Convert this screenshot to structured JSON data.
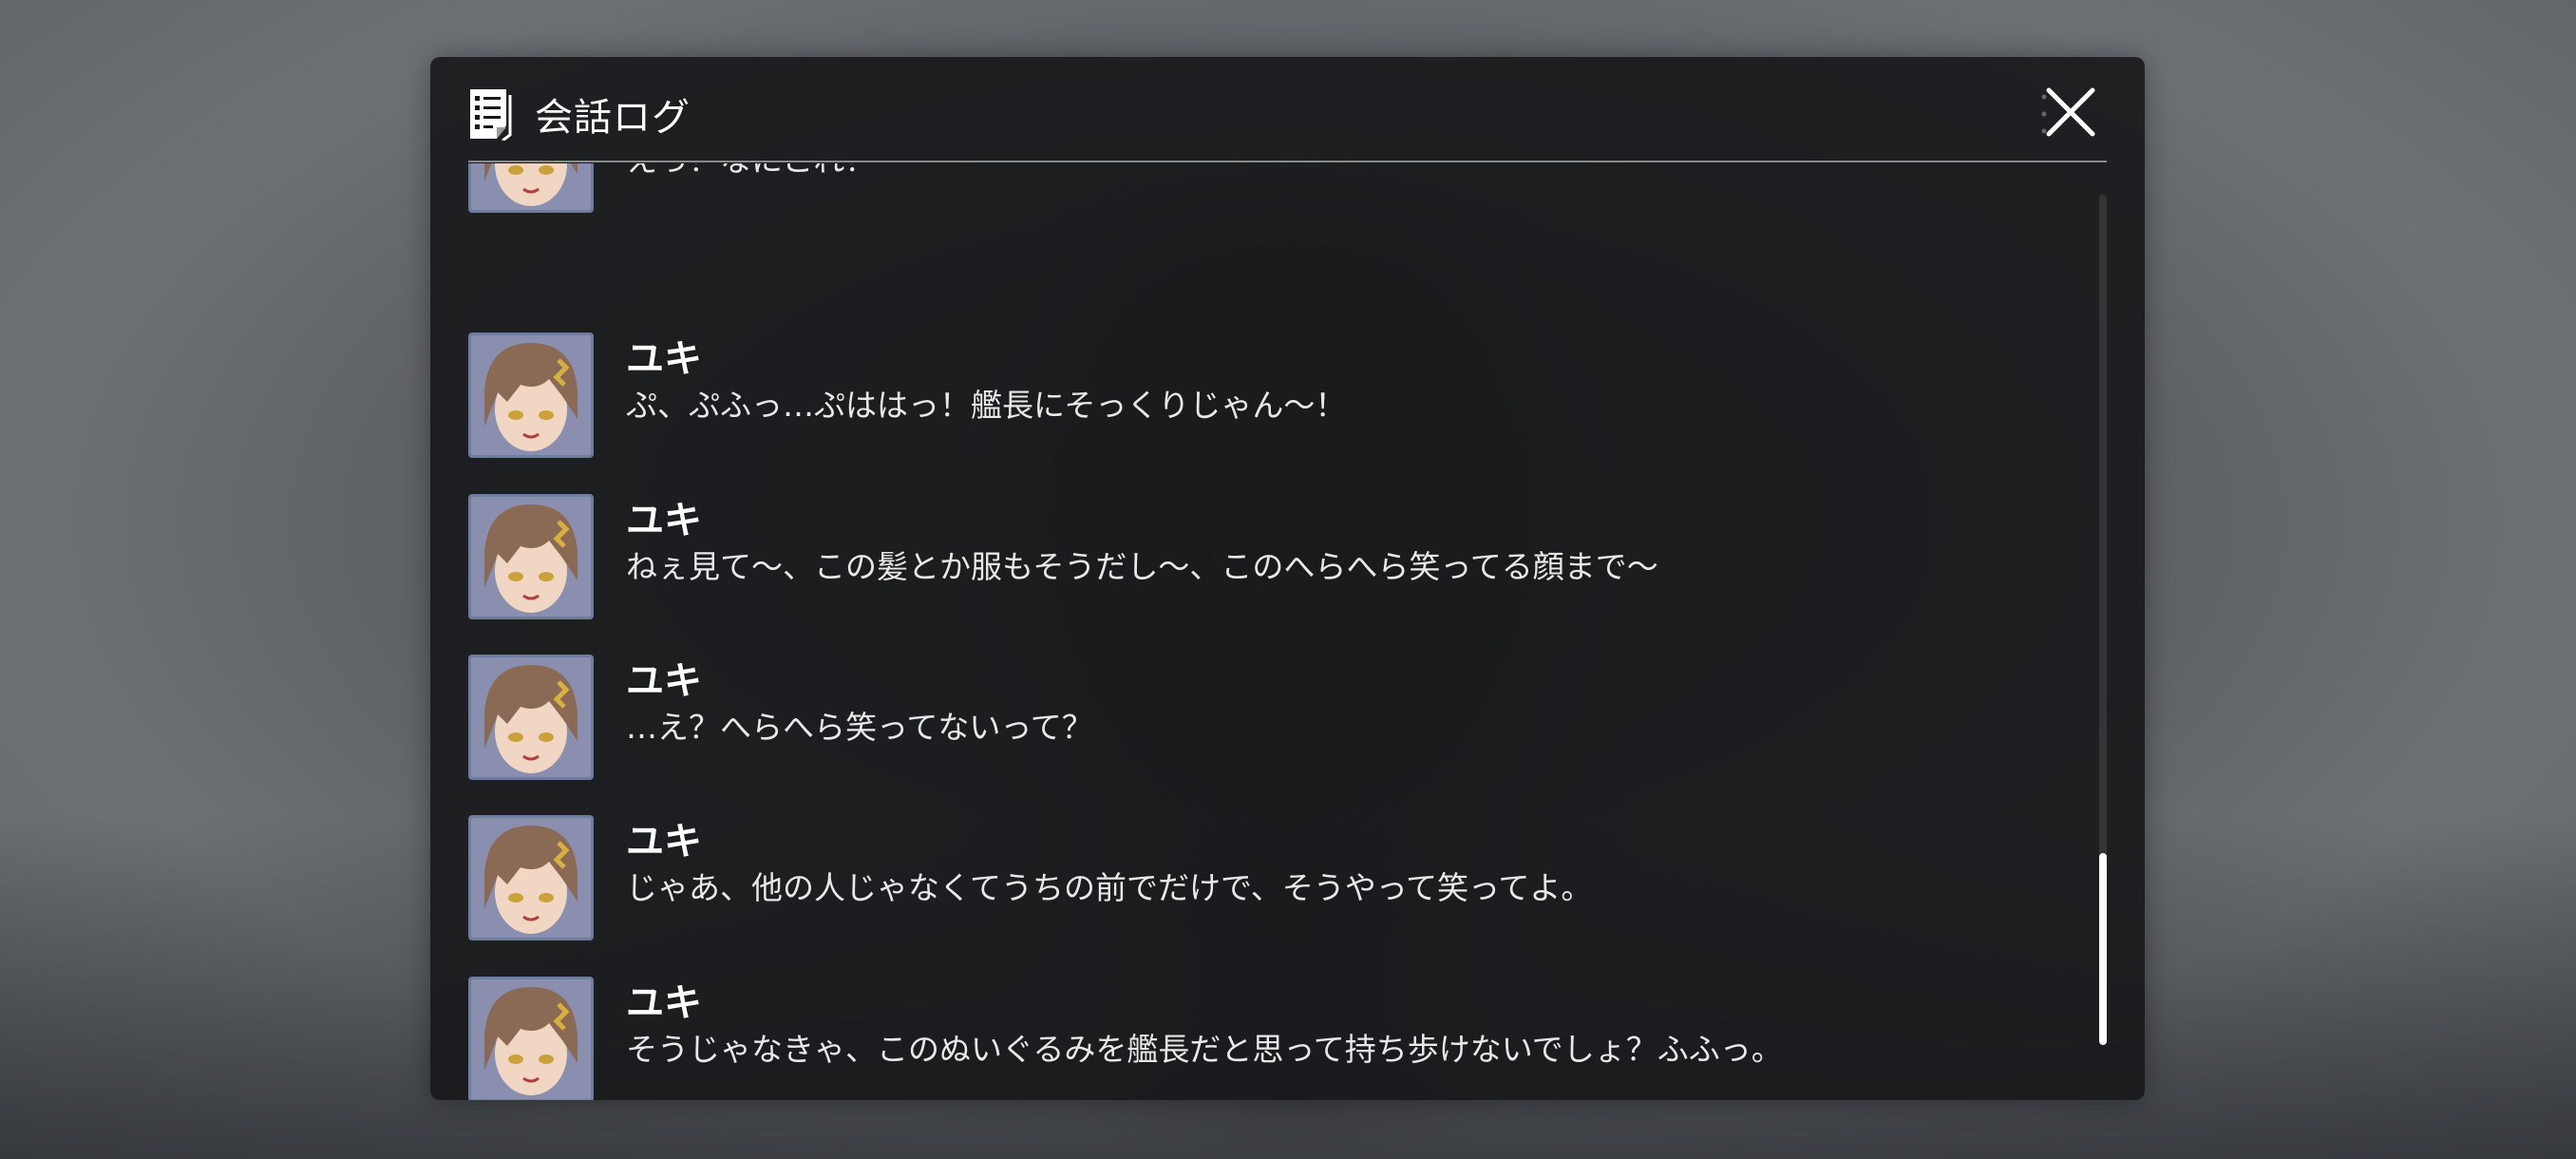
{
  "window": {
    "title": "会話ログ"
  },
  "icons": {
    "log": "document-list-icon",
    "close": "close-x-icon"
  },
  "entries": [
    {
      "speaker": "",
      "text": "えっ？なにこれ？"
    },
    {
      "speaker": "ユキ",
      "text": "ぷ、ぷふっ…ぷははっ！艦長にそっくりじゃん〜！"
    },
    {
      "speaker": "ユキ",
      "text": "ねぇ見て〜、この髪とか服もそうだし〜、このへらへら笑ってる顔まで〜"
    },
    {
      "speaker": "ユキ",
      "text": "…え？へらへら笑ってないって？"
    },
    {
      "speaker": "ユキ",
      "text": "じゃあ、他の人じゃなくてうちの前でだけで、そうやって笑ってよ。"
    },
    {
      "speaker": "ユキ",
      "text": "そうじゃなきゃ、このぬいぐるみを艦長だと思って持ち歩けないでしょ？ふふっ。"
    }
  ],
  "colors": {
    "panel": "#16171a",
    "text": "#e8e8e8",
    "avatar_border": "#6e7c9e"
  }
}
